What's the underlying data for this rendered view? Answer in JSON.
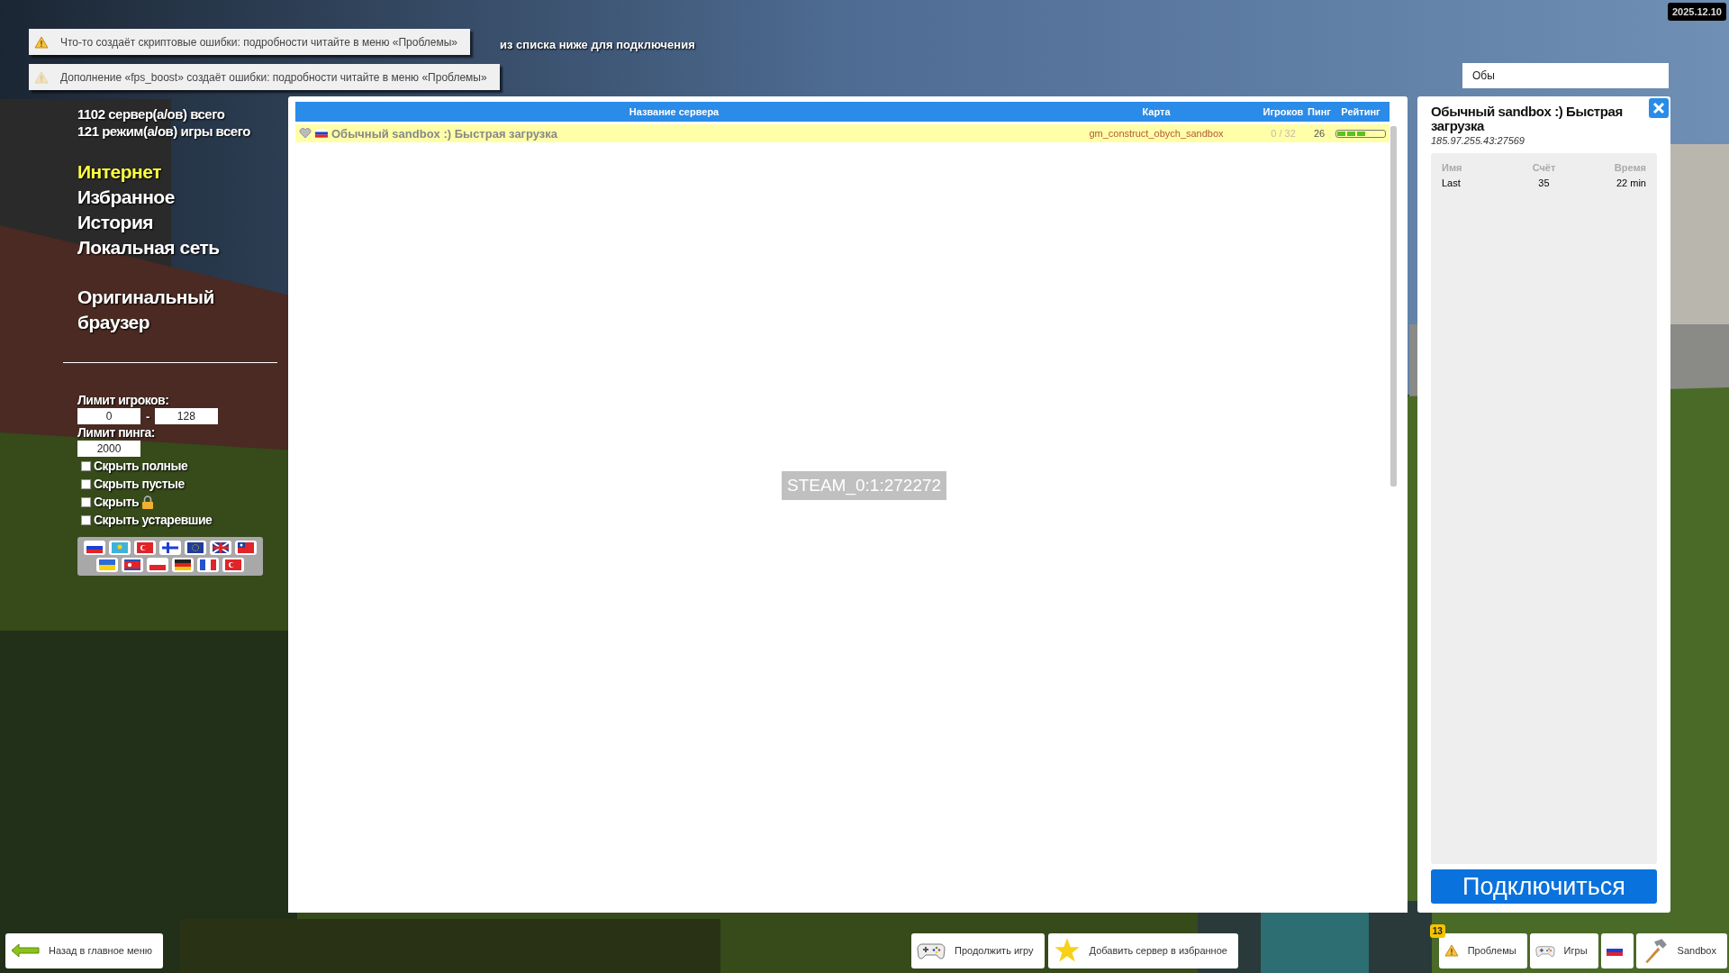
{
  "notifications": [
    {
      "kind": "warning",
      "text": "Что-то создаёт скриптовые ошибки: подробности читайте в меню «Проблемы»"
    },
    {
      "kind": "faded",
      "text": "Дополнение «fps_boost» создаёт ошибки: подробности читайте в меню «Проблемы»"
    }
  ],
  "hint": "из списка ниже для подключения",
  "date": "2025.12.10",
  "sidebar": {
    "stats": [
      "1102 сервер(а/ов) всего",
      "121 режим(а/ов) игры всего"
    ],
    "nav": [
      {
        "label": "Интернет",
        "selected": true
      },
      {
        "label": "Избранное",
        "selected": false
      },
      {
        "label": "История",
        "selected": false
      },
      {
        "label": "Локальная сеть",
        "selected": false
      }
    ],
    "original_browser": "Оригинальный браузер",
    "filters": {
      "players_label": "Лимит игроков:",
      "players_min": "0",
      "dash": "-",
      "players_max": "128",
      "ping_label": "Лимит пинга:",
      "ping_max": "2000",
      "checkboxes": [
        {
          "label": "Скрыть полные",
          "checked": false,
          "kind": "plain"
        },
        {
          "label": "Скрыть пустые",
          "checked": false,
          "kind": "plain"
        },
        {
          "label": "Скрыть",
          "checked": false,
          "kind": "lock"
        },
        {
          "label": "Скрыть устаревшие",
          "checked": false,
          "kind": "plain"
        }
      ]
    }
  },
  "server_list": {
    "columns": [
      "Название сервера",
      "Карта",
      "Игроков",
      "Пинг",
      "Рейтинг"
    ],
    "rows": [
      {
        "name": "Обычный sandbox :) Быстрая загрузка",
        "map": "gm_construct_obych_sandbox",
        "players": "0 / 32",
        "ping": "26",
        "level": 0.6,
        "selected": true,
        "favorite": false
      }
    ]
  },
  "overlay_id": "STEAM_0:1:272272",
  "search": {
    "value": "Обы"
  },
  "details": {
    "title": "Обычный sandbox :) Быстрая загрузка",
    "address": "185.97.255.43:27569",
    "columns": [
      "Имя",
      "Счёт",
      "Время"
    ],
    "players": [
      {
        "name": "Last",
        "score": "35",
        "time": "22 min"
      }
    ],
    "connect": "Подключиться"
  },
  "bottom_bar": {
    "back": "Назад в главное меню",
    "actions": [
      {
        "label": "Продолжить игру",
        "kind": "gamepad"
      },
      {
        "label": "Добавить сервер в избранное",
        "kind": "star"
      }
    ],
    "right": [
      {
        "label": "Проблемы",
        "kind": "warning",
        "badge": "13"
      },
      {
        "label": "Игры",
        "kind": "gamepad"
      },
      {
        "kind": "flag"
      },
      {
        "label": "Sandbox",
        "kind": "hammer"
      }
    ]
  }
}
